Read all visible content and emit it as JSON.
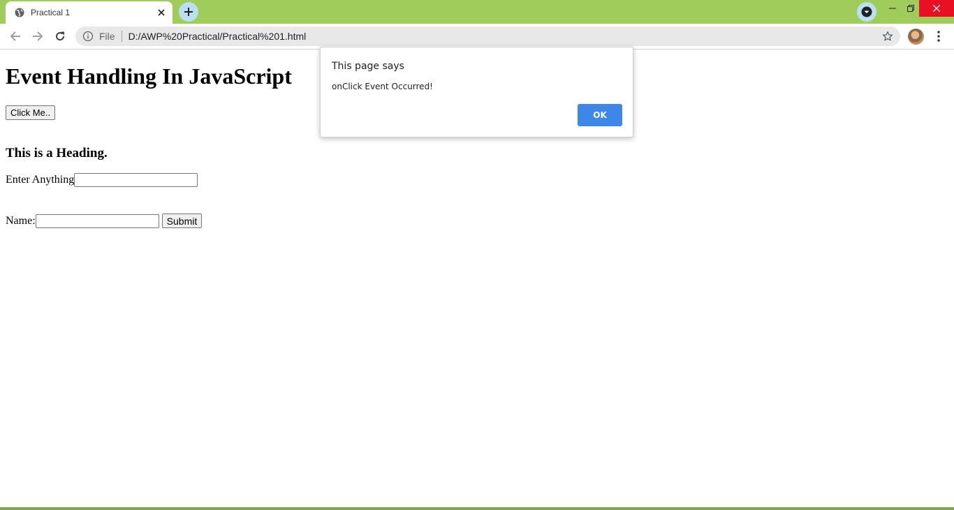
{
  "browser": {
    "tab": {
      "title": "Practical 1"
    },
    "address": {
      "scheme": "File",
      "url": "D:/AWP%20Practical/Practical%201.html"
    },
    "accent_color": "#a0cc5c"
  },
  "page": {
    "heading": "Event Handling In JavaScript",
    "click_button_label": "Click Me..",
    "subheading": "This is a Heading.",
    "anything_label": "Enter Anything",
    "anything_value": "",
    "name_label": "Name:",
    "name_value": "",
    "submit_label": "Submit"
  },
  "dialog": {
    "title": "This page says",
    "message": "onClick Event Occurred!",
    "ok_label": "OK",
    "ok_color": "#3c87e8"
  }
}
